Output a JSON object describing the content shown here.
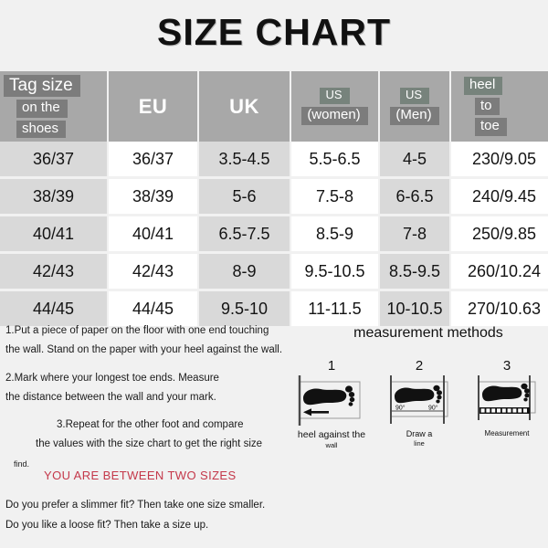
{
  "title": "SIZE CHART",
  "table": {
    "headers": [
      {
        "type": "chips",
        "lines": [
          "Tag size",
          "on the",
          "shoes"
        ],
        "align": "left",
        "tone": "gray"
      },
      {
        "type": "plain",
        "lines": [
          "EU"
        ]
      },
      {
        "type": "plain",
        "lines": [
          "UK"
        ]
      },
      {
        "type": "chips",
        "lines": [
          "US",
          "(women)"
        ],
        "align": "center",
        "tone": "mixed"
      },
      {
        "type": "chips",
        "lines": [
          "US",
          "(Men)"
        ],
        "align": "center",
        "tone": "mixed"
      },
      {
        "type": "chips",
        "lines": [
          "heel",
          "to",
          "toe"
        ],
        "align": "left",
        "tone": "green"
      }
    ],
    "header_labels": {
      "tag_size": "Tag size",
      "on_the": "on the",
      "shoes": "shoes",
      "eu": "EU",
      "uk": "UK",
      "us_1": "US",
      "women": "(women)",
      "us_2": "US",
      "men": "(Men)",
      "heel": "heel",
      "to": "to",
      "toe": "toe"
    },
    "rows": [
      [
        "36/37",
        "36/37",
        "3.5-4.5",
        "5.5-6.5",
        "4-5",
        "230/9.05"
      ],
      [
        "38/39",
        "38/39",
        "5-6",
        "7.5-8",
        "6-6.5",
        "240/9.45"
      ],
      [
        "40/41",
        "40/41",
        "6.5-7.5",
        "8.5-9",
        "7-8",
        "250/9.85"
      ],
      [
        "42/43",
        "42/43",
        "8-9",
        "9.5-10.5",
        "8.5-9.5",
        "260/10.24"
      ],
      [
        "44/45",
        "44/45",
        "9.5-10",
        "11-11.5",
        "10-10.5",
        "270/10.63"
      ]
    ]
  },
  "instructions": {
    "step1_line1": "1.Put a piece of paper on the floor with one end touching",
    "step1_line2": "the wall. Stand on the paper with your heel against the wall.",
    "step2_line1": "2.Mark where your longest toe ends. Measure",
    "step2_line2": "the distance between the wall and your mark.",
    "step3_line1": "3.Repeat for the other foot and compare",
    "step3_line2": "the values with the size chart to get the right size",
    "step3_line3": "find."
  },
  "measurement": {
    "title": "measurement methods",
    "diagrams": [
      {
        "number": "1",
        "caption_line1": "heel against the",
        "caption_line2": "wall"
      },
      {
        "number": "2",
        "caption_line1": "Draw a",
        "caption_line2": "line"
      },
      {
        "number": "3",
        "caption_line1": "Measurement",
        "caption_line2": ""
      }
    ],
    "angle_left": "90°",
    "angle_right": "90°"
  },
  "between_sizes": {
    "heading": "YOU ARE BETWEEN TWO SIZES",
    "fit_line1": "Do you prefer a slimmer fit? Then take one size smaller.",
    "fit_line2": "Do you like a loose fit? Then take a size up."
  },
  "colors": {
    "page_bg": "#f1f1f1",
    "header_bg": "#a8a8a8",
    "chip_gray": "#7c7c7c",
    "chip_green": "#77837c",
    "cell_shade": "#d9d9d9",
    "accent_red": "#c4384a",
    "foot_black": "#111111"
  }
}
